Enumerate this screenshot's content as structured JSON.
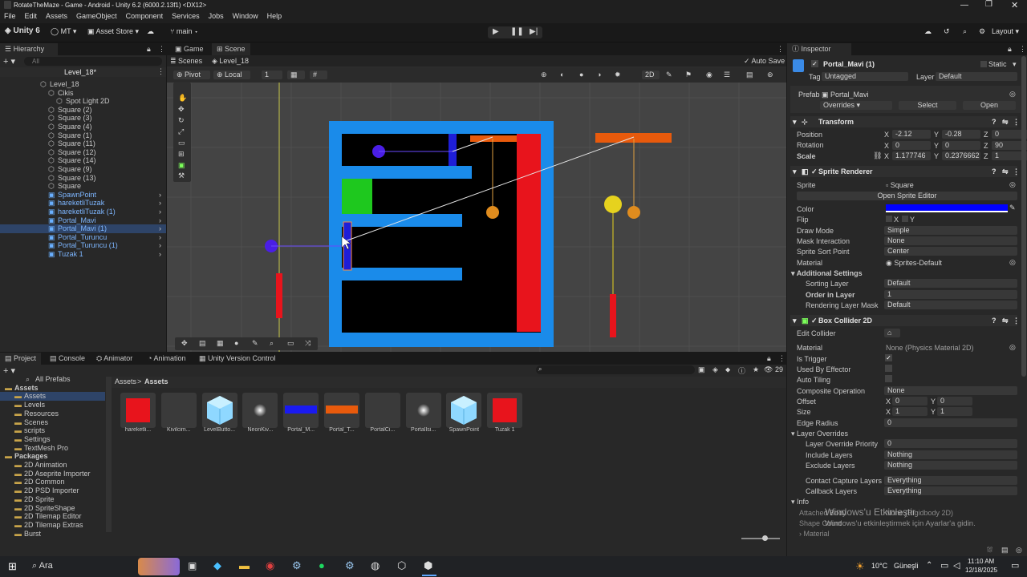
{
  "window": {
    "title": "RotateTheMaze - Game - Android - Unity 6.2 (6000.2.13f1) <DX12>"
  },
  "menu": [
    "File",
    "Edit",
    "Assets",
    "GameObject",
    "Component",
    "Services",
    "Jobs",
    "Window",
    "Help"
  ],
  "toolbar": {
    "unity": "Unity 6",
    "account": "MT",
    "asset_store": "Asset Store",
    "branch": "main",
    "layout": "Layout"
  },
  "hierarchy": {
    "tab": "Hierarchy",
    "search_placeholder": "All",
    "scene": "Level_18*",
    "items": [
      {
        "label": "Level_18",
        "indent": 1,
        "style": "normal"
      },
      {
        "label": "Cikis",
        "indent": 2,
        "style": "normal"
      },
      {
        "label": "Spot Light 2D",
        "indent": 3,
        "style": "normal"
      },
      {
        "label": "Square (2)",
        "indent": 2,
        "style": "normal"
      },
      {
        "label": "Square (3)",
        "indent": 2,
        "style": "normal"
      },
      {
        "label": "Square (4)",
        "indent": 2,
        "style": "normal"
      },
      {
        "label": "Square (1)",
        "indent": 2,
        "style": "normal"
      },
      {
        "label": "Square (11)",
        "indent": 2,
        "style": "normal"
      },
      {
        "label": "Square (12)",
        "indent": 2,
        "style": "normal"
      },
      {
        "label": "Square (14)",
        "indent": 2,
        "style": "normal"
      },
      {
        "label": "Square (9)",
        "indent": 2,
        "style": "normal"
      },
      {
        "label": "Square (13)",
        "indent": 2,
        "style": "normal"
      },
      {
        "label": "Square",
        "indent": 2,
        "style": "normal"
      },
      {
        "label": "SpawnPoint",
        "indent": 2,
        "style": "prefab"
      },
      {
        "label": "hareketliTuzak",
        "indent": 2,
        "style": "prefab"
      },
      {
        "label": "hareketliTuzak (1)",
        "indent": 2,
        "style": "prefab"
      },
      {
        "label": "Portal_Mavi",
        "indent": 2,
        "style": "prefab"
      },
      {
        "label": "Portal_Mavi (1)",
        "indent": 2,
        "style": "selected"
      },
      {
        "label": "Portal_Turuncu",
        "indent": 2,
        "style": "prefab"
      },
      {
        "label": "Portal_Turuncu (1)",
        "indent": 2,
        "style": "prefab"
      },
      {
        "label": "Tuzak 1",
        "indent": 2,
        "style": "prefab"
      }
    ]
  },
  "scene_view": {
    "tabs": [
      "Game",
      "Scene"
    ],
    "breadcrumb": [
      "Scenes",
      "Level_18"
    ],
    "pivot": "Pivot",
    "space": "Local",
    "snap": "1",
    "mode2d": "2D",
    "autosave": "Auto Save"
  },
  "project": {
    "tabs": [
      "Project",
      "Console",
      "Animator",
      "Animation",
      "Unity Version Control"
    ],
    "breadcrumb": [
      "Assets",
      "Assets"
    ],
    "count": "29",
    "tree": [
      {
        "label": "All Prefabs",
        "indent": 1
      },
      {
        "label": "Assets",
        "indent": 0
      },
      {
        "label": "Assets",
        "indent": 1
      },
      {
        "label": "Levels",
        "indent": 1
      },
      {
        "label": "Resources",
        "indent": 1
      },
      {
        "label": "Scenes",
        "indent": 1
      },
      {
        "label": "scripts",
        "indent": 1
      },
      {
        "label": "Settings",
        "indent": 1
      },
      {
        "label": "TextMesh Pro",
        "indent": 1
      },
      {
        "label": "Packages",
        "indent": 0
      },
      {
        "label": "2D Animation",
        "indent": 1
      },
      {
        "label": "2D Aseprite Importer",
        "indent": 1
      },
      {
        "label": "2D Common",
        "indent": 1
      },
      {
        "label": "2D PSD Importer",
        "indent": 1
      },
      {
        "label": "2D Sprite",
        "indent": 1
      },
      {
        "label": "2D SpriteShape",
        "indent": 1
      },
      {
        "label": "2D Tilemap Editor",
        "indent": 1
      },
      {
        "label": "2D Tilemap Extras",
        "indent": 1
      },
      {
        "label": "Burst",
        "indent": 1
      }
    ],
    "assets": [
      {
        "label": "hareketli...",
        "kind": "red-square"
      },
      {
        "label": "Kivilcim...",
        "kind": "blank"
      },
      {
        "label": "LevelButto...",
        "kind": "cube"
      },
      {
        "label": "NeonKiv...",
        "kind": "glow"
      },
      {
        "label": "Portal_M...",
        "kind": "blue-bar"
      },
      {
        "label": "Portal_T...",
        "kind": "orange-bar"
      },
      {
        "label": "PortalCi...",
        "kind": "blank"
      },
      {
        "label": "PortalIsi...",
        "kind": "glow"
      },
      {
        "label": "SpawnPoint",
        "kind": "cube"
      },
      {
        "label": "Tuzak 1",
        "kind": "red-square"
      }
    ]
  },
  "inspector": {
    "tab": "Inspector",
    "object_name": "Portal_Mavi (1)",
    "static": "Static",
    "tag_label": "Tag",
    "tag": "Untagged",
    "layer_label": "Layer",
    "layer": "Default",
    "prefab_label": "Prefab",
    "prefab": "Portal_Mavi",
    "overrides": "Overrides",
    "select": "Select",
    "open": "Open",
    "transform": {
      "title": "Transform",
      "position": {
        "label": "Position",
        "x": "-2.12",
        "y": "-0.28",
        "z": "0"
      },
      "rotation": {
        "label": "Rotation",
        "x": "0",
        "y": "0",
        "z": "90"
      },
      "scale": {
        "label": "Scale",
        "x": "1.177746",
        "y": "0.2376662",
        "z": "1"
      }
    },
    "sprite_renderer": {
      "title": "Sprite Renderer",
      "sprite_label": "Sprite",
      "sprite": "Square",
      "open_editor": "Open Sprite Editor",
      "color_label": "Color",
      "color": "#0000ff",
      "flip_label": "Flip",
      "flip_x": "X",
      "flip_y": "Y",
      "draw_mode_label": "Draw Mode",
      "draw_mode": "Simple",
      "mask_label": "Mask Interaction",
      "mask": "None",
      "sort_point_label": "Sprite Sort Point",
      "sort_point": "Center",
      "material_label": "Material",
      "material": "Sprites-Default",
      "additional": "Additional Settings",
      "sorting_layer_label": "Sorting Layer",
      "sorting_layer": "Default",
      "order_label": "Order in Layer",
      "order": "1",
      "rendering_layer_label": "Rendering Layer Mask",
      "rendering_layer": "Default"
    },
    "box_collider": {
      "title": "Box Collider 2D",
      "edit_label": "Edit Collider",
      "material_label": "Material",
      "material": "None (Physics Material 2D)",
      "trigger_label": "Is Trigger",
      "effector_label": "Used By Effector",
      "autotiling_label": "Auto Tiling",
      "composite_label": "Composite Operation",
      "composite": "None",
      "offset_label": "Offset",
      "offset_x": "0",
      "offset_y": "0",
      "size_label": "Size",
      "size_x": "1",
      "size_y": "1",
      "edge_label": "Edge Radius",
      "edge": "0",
      "layer_overrides": "Layer Overrides",
      "priority_label": "Layer Override Priority",
      "priority": "0",
      "include_label": "Include Layers",
      "include": "Nothing",
      "exclude_label": "Exclude Layers",
      "exclude": "Nothing",
      "contact_label": "Contact Capture Layers",
      "contact": "Everything",
      "callback_label": "Callback Layers",
      "callback": "Everything",
      "info": "Info",
      "attached_label": "Attached Body",
      "attached": "None (Rigidbody 2D)",
      "shape_label": "Shape Count",
      "material2_label": "Material"
    },
    "watermark": {
      "line1": "Windows'u Etkinleştir",
      "line2": "Windows'u etkinleştirmek için Ayarlar'a gidin."
    }
  },
  "taskbar": {
    "search": "Ara",
    "weather": "10°C",
    "weather_text": "Güneşli",
    "time": "11:10 AM",
    "date": "12/18/2025"
  },
  "colors": {
    "accent": "#3d7bd9",
    "maze_blue": "#1a8bea",
    "red": "#e8141c",
    "orange": "#e85a0c",
    "green": "#1ec81e",
    "purple": "#4a1ee6",
    "yellow": "#e6d21e"
  }
}
